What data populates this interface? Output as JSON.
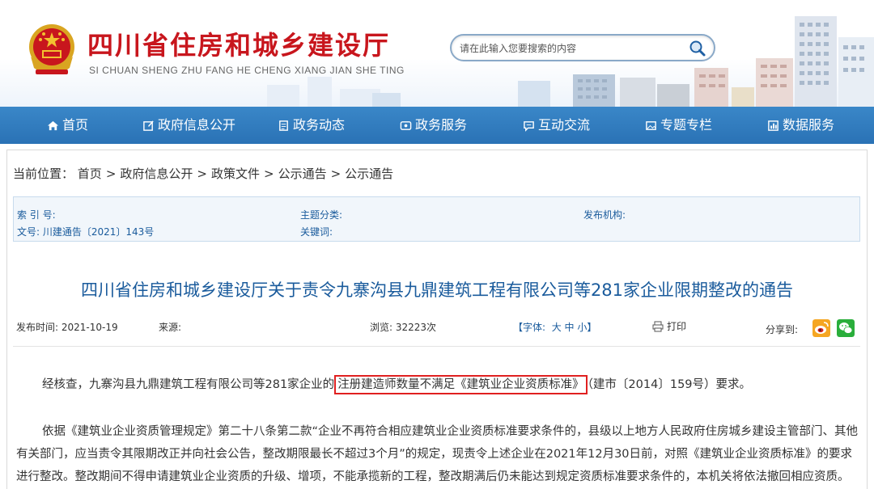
{
  "header": {
    "title": "四川省住房和城乡建设厅",
    "subtitle": "SI CHUAN SHENG ZHU FANG HE CHENG XIANG JIAN SHE TING",
    "search_placeholder": "请在此输入您要搜索的内容",
    "brand_color": "#c8161d"
  },
  "nav": {
    "items": [
      {
        "label": "首页",
        "icon": "home-icon"
      },
      {
        "label": "政府信息公开",
        "icon": "edit-icon"
      },
      {
        "label": "政务动态",
        "icon": "news-icon"
      },
      {
        "label": "政务服务",
        "icon": "service-icon"
      },
      {
        "label": "互动交流",
        "icon": "chat-icon"
      },
      {
        "label": "专题专栏",
        "icon": "image-icon"
      },
      {
        "label": "数据服务",
        "icon": "data-icon"
      }
    ],
    "color": "#2f7bbf"
  },
  "breadcrumb": {
    "label": "当前位置：",
    "items": [
      "首页",
      "政府信息公开",
      "政策文件",
      "公示通告",
      "公示通告"
    ],
    "separator": ">"
  },
  "meta": {
    "index_no": "索 引 号:",
    "topic": "主题分类:",
    "publisher": "发布机构:",
    "doc_no": "文号: 川建通告〔2021〕143号",
    "keywords": "关键词:"
  },
  "article": {
    "title": "四川省住房和城乡建设厅关于责令九寨沟县九鼎建筑工程有限公司等281家企业限期整改的通告",
    "publish_time": "发布时间:   2021-10-19",
    "source": "来源:",
    "views": "浏览:  32223次",
    "font_label": "【字体:",
    "font_large": "大",
    "font_medium": "中",
    "font_small": "小】",
    "print": "打印",
    "share": "分享到:",
    "para1_before": "经核查，九寨沟县九鼎建筑工程有限公司等281家企业的",
    "para1_highlight": "注册建造师数量不满足《建筑业企业资质标准》",
    "para1_after": "（建市〔2014〕159号）要求。",
    "para2": "依据《建筑业企业资质管理规定》第二十八条第二款“企业不再符合相应建筑业企业资质标准要求条件的，县级以上地方人民政府住房城乡建设主管部门、其他有关部门，应当责令其限期改正并向社会公告，整改期限最长不超过3个月”的规定，现责令上述企业在2021年12月30日前，对照《建筑业企业资质标准》的要求进行整改。整改期间不得申请建筑业企业资质的升级、增项，不能承揽新的工程，整改期满后仍未能达到规定资质标准要求条件的，本机关将依法撤回相应资质。"
  }
}
